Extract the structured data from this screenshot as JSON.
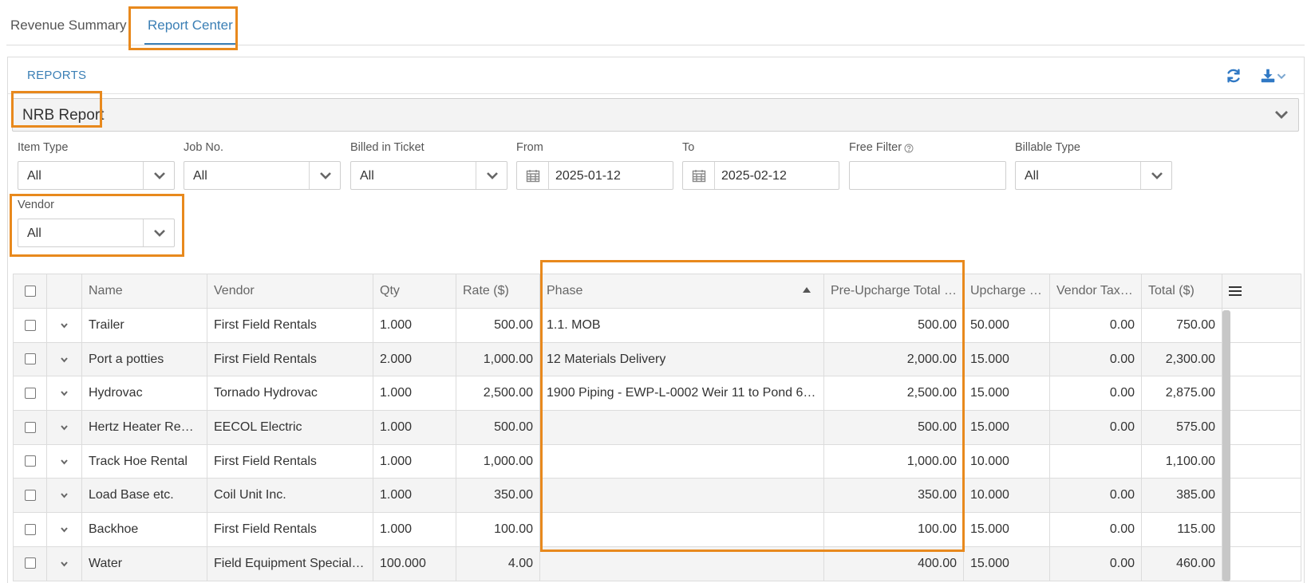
{
  "tabs": [
    {
      "label": "Revenue Summary"
    },
    {
      "label": "Report Center"
    }
  ],
  "panel": {
    "title": "REPORTS",
    "icons": {
      "refresh": "refresh-icon",
      "download": "download-icon",
      "download_menu": "chevron-down-icon"
    }
  },
  "report_select": {
    "value": "NRB Report"
  },
  "filters": {
    "item_type": {
      "label": "Item Type",
      "value": "All"
    },
    "job_no": {
      "label": "Job No.",
      "value": "All"
    },
    "billed_in_ticket": {
      "label": "Billed in Ticket",
      "value": "All"
    },
    "from": {
      "label": "From",
      "value": "2025-01-12"
    },
    "to": {
      "label": "To",
      "value": "2025-02-12"
    },
    "free_filter": {
      "label": "Free Filter",
      "value": ""
    },
    "billable_type": {
      "label": "Billable Type",
      "value": "All"
    },
    "vendor": {
      "label": "Vendor",
      "value": "All"
    }
  },
  "table": {
    "columns": [
      "Name",
      "Vendor",
      "Qty",
      "Rate ($)",
      "Phase",
      "Pre-Upcharge Total ($)",
      "Upcharge (...",
      "Vendor Tax (...",
      "Total ($)"
    ],
    "rows": [
      {
        "name": "Trailer",
        "vendor": "First Field Rentals",
        "qty": "1.000",
        "rate": "500.00",
        "phase": "1.1. MOB",
        "pre_total": "500.00",
        "upcharge": "50.000",
        "vendor_tax": "0.00",
        "total": "750.00"
      },
      {
        "name": "Port a potties",
        "vendor": "First Field Rentals",
        "qty": "2.000",
        "rate": "1,000.00",
        "phase": "12 Materials Delivery",
        "pre_total": "2,000.00",
        "upcharge": "15.000",
        "vendor_tax": "0.00",
        "total": "2,300.00"
      },
      {
        "name": "Hydrovac",
        "vendor": "Tornado Hydrovac",
        "qty": "1.000",
        "rate": "2,500.00",
        "phase": "1900 Piping - EWP-L-0002 Weir 11 to Pond 6 Pi...",
        "pre_total": "2,500.00",
        "upcharge": "15.000",
        "vendor_tax": "0.00",
        "total": "2,875.00"
      },
      {
        "name": "Hertz Heater Rent...",
        "vendor": "EECOL Electric",
        "qty": "1.000",
        "rate": "500.00",
        "phase": "",
        "pre_total": "500.00",
        "upcharge": "15.000",
        "vendor_tax": "0.00",
        "total": "575.00"
      },
      {
        "name": "Track Hoe Rental",
        "vendor": "First Field Rentals",
        "qty": "1.000",
        "rate": "1,000.00",
        "phase": "",
        "pre_total": "1,000.00",
        "upcharge": "10.000",
        "vendor_tax": "",
        "total": "1,100.00"
      },
      {
        "name": "Load Base etc.",
        "vendor": "Coil Unit Inc.",
        "qty": "1.000",
        "rate": "350.00",
        "phase": "",
        "pre_total": "350.00",
        "upcharge": "10.000",
        "vendor_tax": "0.00",
        "total": "385.00"
      },
      {
        "name": "Backhoe",
        "vendor": "First Field Rentals",
        "qty": "1.000",
        "rate": "100.00",
        "phase": "",
        "pre_total": "100.00",
        "upcharge": "15.000",
        "vendor_tax": "0.00",
        "total": "115.00"
      },
      {
        "name": "Water",
        "vendor": "Field Equipment Specialis...",
        "qty": "100.000",
        "rate": "4.00",
        "phase": "",
        "pre_total": "400.00",
        "upcharge": "15.000",
        "vendor_tax": "0.00",
        "total": "460.00"
      }
    ],
    "sort": {
      "column": "Phase",
      "direction": "ascending"
    }
  },
  "colors": {
    "accent": "#3b7fb5",
    "highlight": "#e8891d",
    "icon_blue": "#2f78c4"
  }
}
